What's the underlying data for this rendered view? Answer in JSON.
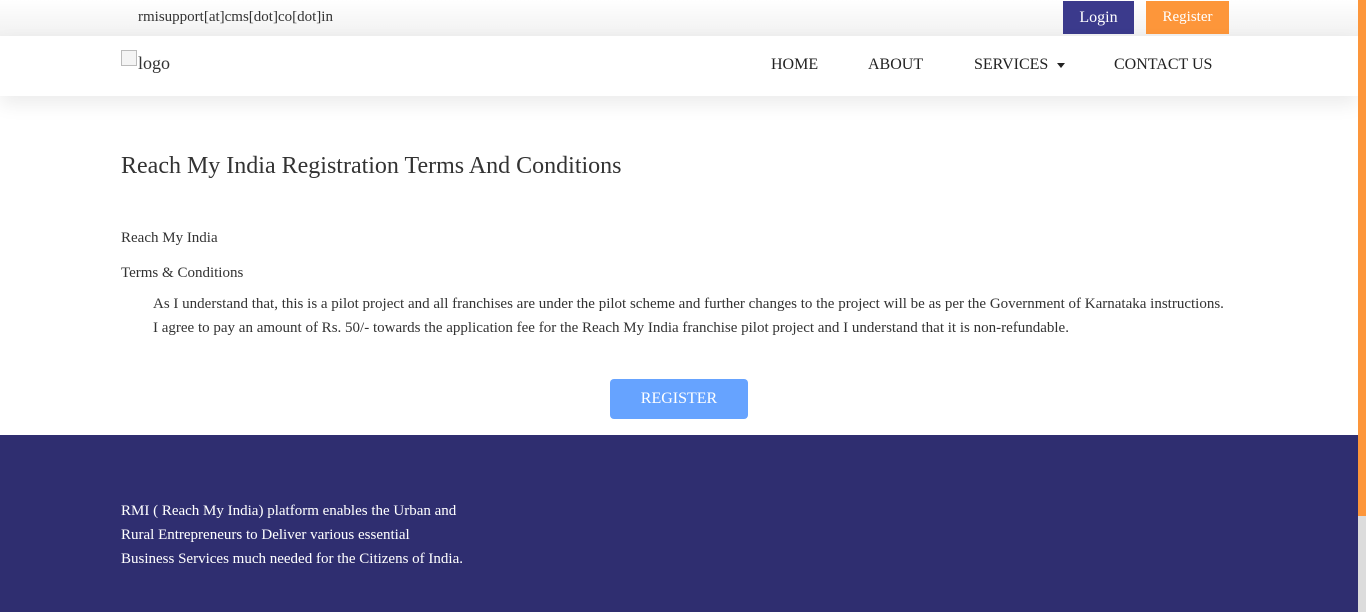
{
  "topbar": {
    "email": "rmisupport[at]cms[dot]co[dot]in",
    "login_label": "Login",
    "register_label": "Register"
  },
  "navbar": {
    "logo_alt": "logo",
    "items": [
      {
        "label": "HOME"
      },
      {
        "label": "ABOUT"
      },
      {
        "label": "SERVICES",
        "has_dropdown": true
      },
      {
        "label": "CONTACT US"
      }
    ]
  },
  "main": {
    "title": "Reach My India Registration Terms And Conditions",
    "org_name": "Reach My India",
    "terms_heading": "Terms & Conditions",
    "terms": [
      "As I understand that, this is a pilot project and all franchises are under the pilot scheme and further changes to the project will be as per the Government of Karnataka instructions.",
      "I agree to pay an amount of Rs. 50/- towards the application fee for the Reach My India franchise pilot project and I understand that it is non-refundable."
    ],
    "register_button": "REGISTER"
  },
  "footer": {
    "description": "RMI ( Reach My India) platform enables the Urban and Rural Entrepreneurs to Deliver various essential Business Services much needed for the Citizens of India."
  },
  "colors": {
    "brand_primary": "#3b3a8c",
    "brand_accent": "#fd963a",
    "register_button": "#66a3ff",
    "footer_bg": "#2f2e70"
  }
}
